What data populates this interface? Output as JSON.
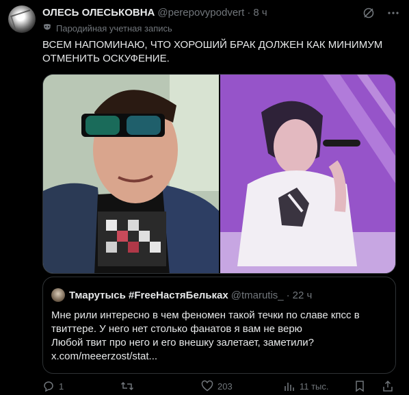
{
  "tweet": {
    "display_name": "ОЛЕСЬ ОЛЕСЬКОВНА",
    "handle": "@perepovypodvert",
    "separator": "·",
    "time": "8 ч",
    "parody_label": "Пародийная учетная запись",
    "text_lines": [
      "ВСЕМ НАПОМИНАЮ, ЧТО ХОРОШИЙ БРАК ДОЛЖЕН КАК МИНИМУМ",
      "ОТМЕНИТЬ ОСКУФЕНИЕ."
    ]
  },
  "quote": {
    "display_name": "Тмарутысь #FreeНастяБельках",
    "handle": "@tmarutis_",
    "separator": "·",
    "time": "22 ч",
    "text_lines": [
      "Мне рили интересно в чем феномен такой течки по славе кпсс в",
      "твиттере. У него нет столько фанатов я вам не верю",
      "Любой твит про него и его внешку залетает, заметили?",
      "x.com/meeerzost/stat..."
    ]
  },
  "actions": {
    "replies": "1",
    "retweets": "",
    "likes": "203",
    "views": "11 тыс."
  },
  "icons": {
    "grok": "grok-icon",
    "more": "more-icon",
    "parody": "parody-mask-icon",
    "reply": "reply-icon",
    "retweet": "retweet-icon",
    "like": "like-icon",
    "views": "views-icon",
    "bookmark": "bookmark-icon",
    "share": "share-icon"
  },
  "colors": {
    "background": "#000000",
    "text": "#e7e9ea",
    "muted": "#71767b",
    "border": "#2f3336"
  }
}
